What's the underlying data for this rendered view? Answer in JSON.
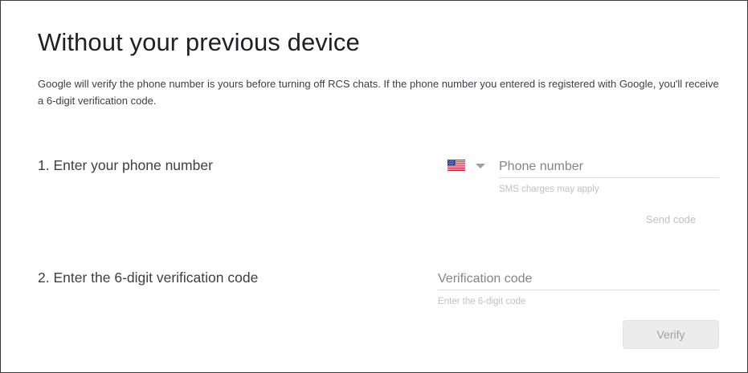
{
  "header": {
    "title": "Without your previous device",
    "description": "Google will verify the phone number is yours before turning off RCS chats. If the phone number you entered is registered with Google, you'll receive a 6-digit verification code."
  },
  "step1": {
    "label": "1. Enter your phone number",
    "country_icon": "us-flag-icon",
    "phone_placeholder": "Phone number",
    "phone_value": "",
    "hint": "SMS charges may apply",
    "send_code_label": "Send code"
  },
  "step2": {
    "label": "2. Enter the 6-digit verification code",
    "code_placeholder": "Verification code",
    "code_value": "",
    "hint": "Enter the 6-digit code",
    "verify_label": "Verify"
  },
  "colors": {
    "text_primary": "#202124",
    "text_secondary": "#3c4043",
    "hint_text": "#bdc1c6",
    "disabled_button_bg": "#ececec",
    "divider": "#dadce0"
  }
}
